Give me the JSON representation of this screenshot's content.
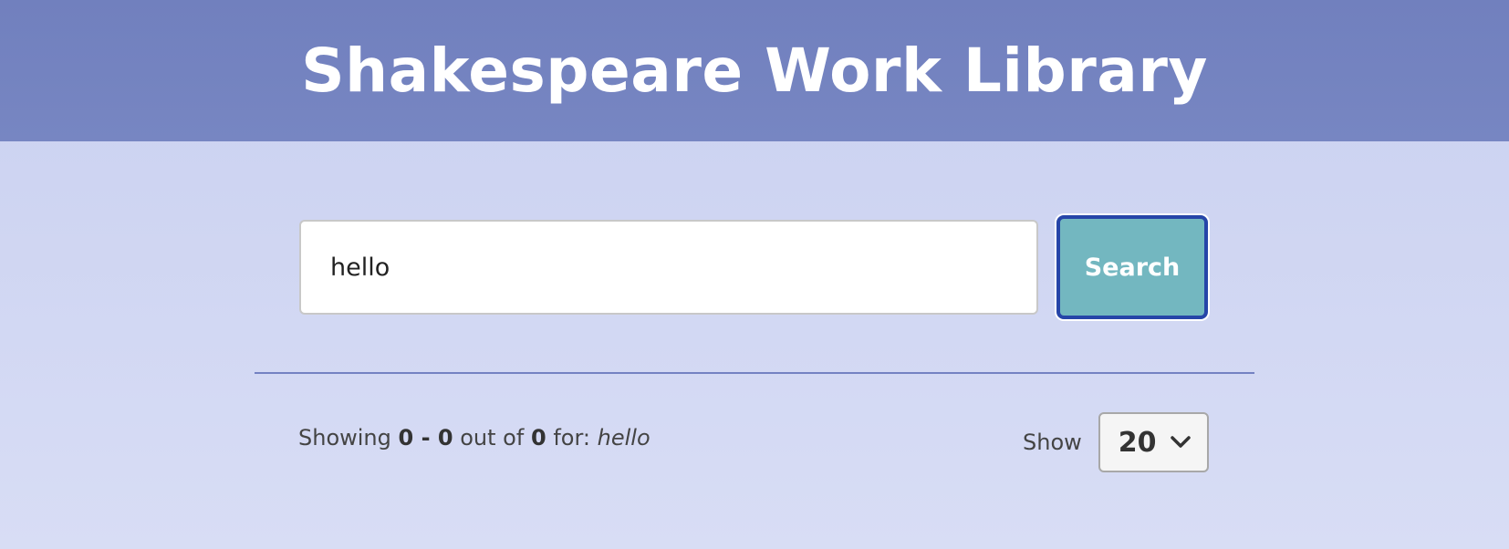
{
  "header": {
    "title": "Shakespeare Work Library"
  },
  "search": {
    "value": "hello",
    "button_label": "Search"
  },
  "results": {
    "prefix": "Showing",
    "range_start": "0",
    "range_sep": "-",
    "range_end": "0",
    "out_of_label": "out of",
    "total": "0",
    "for_label": "for:",
    "query": "hello"
  },
  "pagination": {
    "show_label": "Show",
    "per_page": "20"
  },
  "colors": {
    "header_bg": "#7382c0",
    "page_bg": "#cdd3f1",
    "button_bg": "#73b7c0",
    "button_border": "#2645a8",
    "divider": "#7382c2"
  }
}
